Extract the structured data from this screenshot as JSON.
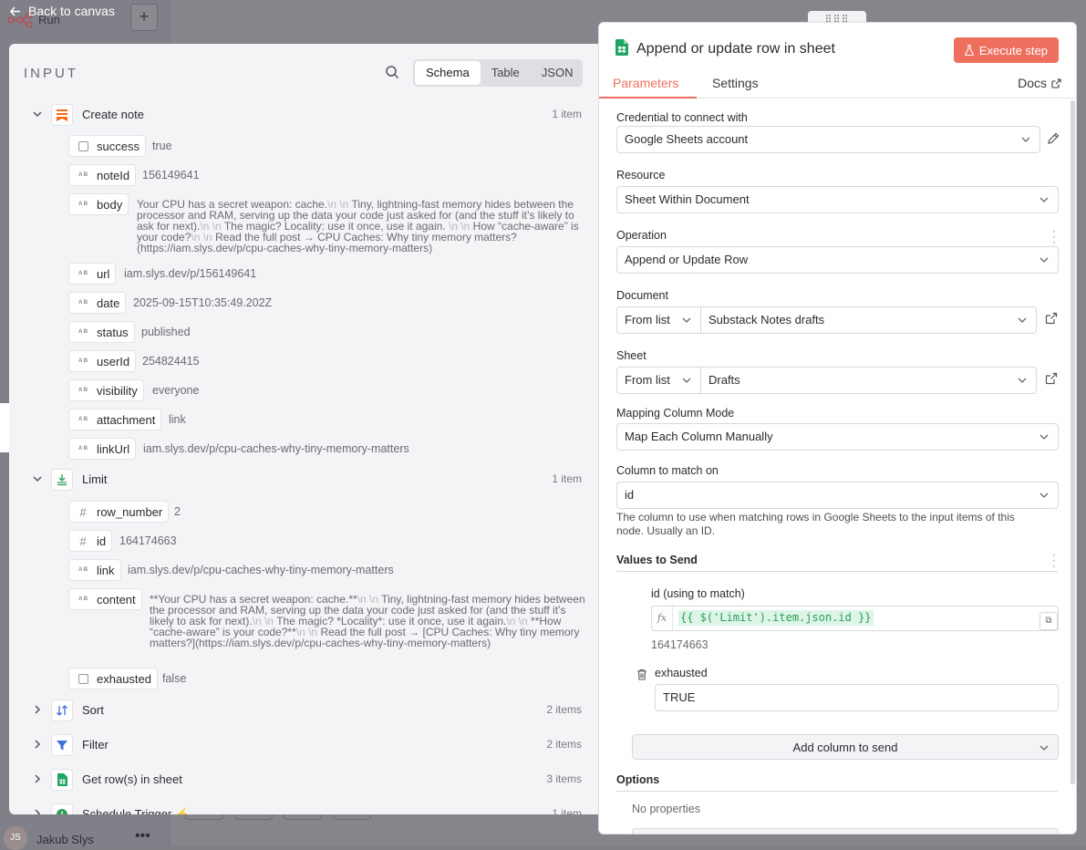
{
  "back_label": "Back to canvas",
  "background": {
    "workflow_title": "Run",
    "user_initials": "JS",
    "user_name": "Jakub Slys",
    "menu_glyph": "•••",
    "plus_glyph": "+"
  },
  "input_panel": {
    "title": "INPUT",
    "view_modes": [
      "Schema",
      "Table",
      "JSON"
    ],
    "active_view": "Schema",
    "nodes": [
      {
        "name": "Create note",
        "count": "1 item",
        "expanded": true,
        "icon": "substack-icon",
        "fields": [
          {
            "key": "success",
            "type": "boolean",
            "value": "true"
          },
          {
            "key": "noteId",
            "type": "string",
            "value": "156149641"
          },
          {
            "key": "body",
            "type": "string",
            "value_parts": [
              "Your CPU has a secret weapon: cache.",
              "\\n \\n",
              " Tiny, lightning-fast memory hides between the processor and RAM, serving up the data your code just asked for (and the stuff it’s likely to ask for next).",
              "\\n \\n",
              " The magic? Locality: use it once, use it again. ",
              "\\n \\n",
              " How “cache-aware” is your code?",
              "\\n \\n",
              " Read the full post → CPU Caches: Why tiny memory matters? (https://iam.slys.dev/p/cpu-caches-why-tiny-memory-matters)"
            ]
          },
          {
            "key": "url",
            "type": "string",
            "value": "iam.slys.dev/p/156149641"
          },
          {
            "key": "date",
            "type": "string",
            "value": "2025-09-15T10:35:49.202Z"
          },
          {
            "key": "status",
            "type": "string",
            "value": "published"
          },
          {
            "key": "userId",
            "type": "string",
            "value": "254824415"
          },
          {
            "key": "visibility",
            "type": "string",
            "value": "everyone"
          },
          {
            "key": "attachment",
            "type": "string",
            "value": "link"
          },
          {
            "key": "linkUrl",
            "type": "string",
            "value": "iam.slys.dev/p/cpu-caches-why-tiny-memory-matters"
          }
        ]
      },
      {
        "name": "Limit",
        "count": "1 item",
        "expanded": true,
        "icon": "limit-icon",
        "fields": [
          {
            "key": "row_number",
            "type": "number",
            "value": "2"
          },
          {
            "key": "id",
            "type": "number",
            "value": "164174663"
          },
          {
            "key": "link",
            "type": "string",
            "value": "iam.slys.dev/p/cpu-caches-why-tiny-memory-matters"
          },
          {
            "key": "content",
            "type": "string",
            "value_parts": [
              "**Your CPU has a secret weapon: cache.**",
              "\\n \\n",
              " Tiny, lightning-fast memory hides between the processor and RAM, serving up the data your code just asked for (and the stuff it’s likely to ask for next).",
              "\\n \\n",
              " The magic? *Locality*: use it once, use it again.",
              "\\n \\n",
              " **How “cache-aware” is your code?**",
              "\\n \\n",
              " Read the full post → [CPU Caches: Why tiny memory matters?](https://iam.slys.dev/p/cpu-caches-why-tiny-memory-matters)"
            ]
          },
          {
            "key": "exhausted",
            "type": "boolean",
            "value": "false"
          }
        ]
      },
      {
        "name": "Sort",
        "count": "2 items",
        "expanded": false,
        "icon": "sort-icon"
      },
      {
        "name": "Filter",
        "count": "2 items",
        "expanded": false,
        "icon": "filter-icon"
      },
      {
        "name": "Get row(s) in sheet",
        "count": "3 items",
        "expanded": false,
        "icon": "google-sheets-icon"
      },
      {
        "name": "Schedule Trigger",
        "count": "1 item",
        "expanded": false,
        "icon": "clock-icon"
      }
    ]
  },
  "node_panel": {
    "title": "Append or update row in sheet",
    "execute_label": "Execute step",
    "tabs": [
      "Parameters",
      "Settings"
    ],
    "active_tab": "Parameters",
    "docs_label": "Docs",
    "credential": {
      "label": "Credential to connect with",
      "value": "Google Sheets account"
    },
    "resource": {
      "label": "Resource",
      "value": "Sheet Within Document"
    },
    "operation": {
      "label": "Operation",
      "value": "Append or Update Row"
    },
    "document": {
      "label": "Document",
      "mode": "From list",
      "value": "Substack Notes drafts"
    },
    "sheet": {
      "label": "Sheet",
      "mode": "From list",
      "value": "Drafts"
    },
    "mapping_mode": {
      "label": "Mapping Column Mode",
      "value": "Map Each Column Manually"
    },
    "match_column": {
      "label": "Column to match on",
      "value": "id",
      "hint": "The column to use when matching rows in Google Sheets to the input items of this node. Usually an ID."
    },
    "values_to_send": {
      "title": "Values to Send",
      "id_field": {
        "label": "id (using to match)",
        "fx": "fx",
        "expression": "{{ $('Limit').item.json.id }}",
        "preview": "164174663"
      },
      "exhausted_field": {
        "label": "exhausted",
        "value": "TRUE"
      },
      "add_column_label": "Add column to send"
    },
    "options": {
      "title": "Options",
      "empty_text": "No properties"
    },
    "accent_color": "#ef6f5e"
  }
}
